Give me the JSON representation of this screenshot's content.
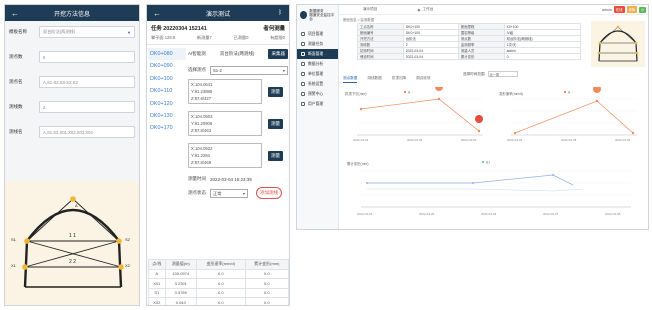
{
  "panel1": {
    "header": {
      "back_icon": "arrow-left-icon",
      "title": "开挖方法信息"
    },
    "fields": [
      {
        "label": "模板名称",
        "value": "双台阶法(两测线)",
        "dropdown": true
      },
      {
        "label": "测点数",
        "value": "5"
      },
      {
        "label": "测点名",
        "value": "A,S1-S2,S3-S2,S2"
      },
      {
        "label": "测线数",
        "value": "2"
      },
      {
        "label": "测线名",
        "value": "A,S1,S2,X01,X02,X03,X04"
      }
    ],
    "diagram": {
      "line1": "1 1",
      "line2": "2 2",
      "pt_a": "A",
      "pt_s1": "S1",
      "pt_s2": "S2",
      "pt_x1": "X1",
      "pt_x2": "X2"
    }
  },
  "panel2": {
    "header": {
      "back_icon": "arrow-left-icon",
      "title": "演示测试",
      "bt_icon": "bluetooth-icon"
    },
    "task": {
      "label": "任务 20220304 152141",
      "status": "者何测量"
    },
    "stats": {
      "total": "掌子面 129.8",
      "a": "新测量7",
      "b": "已测量0",
      "c": "有超限0"
    },
    "chainages": [
      "DK0+080",
      "DK0+090",
      "DK0+100",
      "DK0+110",
      "DK0+120",
      "DK0+130",
      "DK0+170"
    ],
    "instrument": {
      "label": "AI智能测",
      "value": "双台阶法(两测线)",
      "button": "采集器"
    },
    "select": {
      "label": "选择测点",
      "value": "S1-2"
    },
    "points": [
      {
        "x": "X:104.0641",
        "y": "Y:91.23885",
        "z": "Z:97.8/427",
        "btn": "测量"
      },
      {
        "x": "X:104.0903",
        "y": "Y:91.20906",
        "z": "Z:97.8/463",
        "btn": "测量"
      },
      {
        "x": "X:104.0922",
        "y": "Y:91.2284",
        "z": "Z:97.8/469",
        "btn": "测量"
      }
    ],
    "time": {
      "label": "测量时间",
      "value": "2022-03-04 15:23:39"
    },
    "footer": {
      "label": "测点状态",
      "value": "正常",
      "button": "添加测线"
    },
    "table": [
      [
        "点/线",
        "测量值(m)",
        "变形速率(mm/d)",
        "累计变形(mm)"
      ],
      [
        "A",
        "100.0974",
        "0.0",
        "0.0"
      ],
      [
        "X01",
        "3.2391",
        "0.0",
        "0.0"
      ],
      [
        "S1",
        "0.9789",
        "0.0",
        "0.0"
      ],
      [
        "X02",
        "0.043",
        "0.0",
        "0.0"
      ]
    ]
  },
  "panel3": {
    "logo": {
      "name": "数据服务",
      "sub": "隧道安全监控平台"
    },
    "menu": [
      {
        "label": "项目管理",
        "active": false
      },
      {
        "label": "测量任务",
        "active": false
      },
      {
        "label": "断面管理",
        "active": true
      },
      {
        "label": "数据分析",
        "active": false
      },
      {
        "label": "单位管理",
        "active": false
      },
      {
        "label": "系统设置",
        "active": false
      },
      {
        "label": "预警中心",
        "active": false
      },
      {
        "label": "用户管理",
        "active": false
      }
    ],
    "topbar": {
      "project": "演示项目",
      "station": "工作台",
      "user": "admin",
      "badge1": "在线",
      "badge2": "切换"
    },
    "breadcrumb": "断面信息 > 监测数据",
    "info": [
      [
        "工点名称",
        "DK0+100",
        "断面里程",
        "K0+100"
      ],
      [
        "断面编号",
        "DK0+100",
        "围岩等级",
        "IV级"
      ],
      [
        "开挖方法",
        "台阶法",
        "测点数",
        "双台阶法(两测线)"
      ],
      [
        "测线数",
        "2",
        "监测频率",
        "1次/天"
      ],
      [
        "初测时间",
        "2022-03-04",
        "测量人员",
        "admin"
      ],
      [
        "埋设时间",
        "2022-03-04",
        "累计变形",
        "0"
      ]
    ],
    "tabs": [
      "测点数据",
      "测线数据",
      "拱顶沉降",
      "周边收敛"
    ],
    "control": {
      "label": "选择时间范围",
      "value": "近一周"
    },
    "chart1": {
      "ylabel": "拱顶下沉(mm)",
      "legend": "A",
      "xticks": [
        "2022-03-04",
        "2022-03-05",
        "2022-03-06"
      ]
    },
    "chart2": {
      "ylabel": "变形速率(mm/d)",
      "legend": "A",
      "xticks": [
        "2022-03-04",
        "2022-03-05",
        "2022-03-06"
      ]
    },
    "chart3": {
      "ylabel": "累计变形(mm)",
      "legend": "S1",
      "xticks": [
        "2022-03-04",
        "2022-03-05",
        "2022-03-06",
        "2022-03-07",
        "2022-03-08"
      ]
    }
  }
}
